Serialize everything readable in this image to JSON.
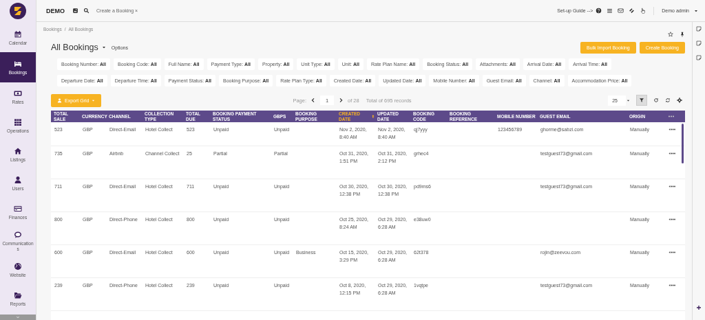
{
  "sidebar": {
    "items": [
      {
        "label": "Calendar",
        "selected": false
      },
      {
        "label": "Bookings",
        "selected": true
      },
      {
        "label": "Rates",
        "selected": false
      },
      {
        "label": "Operations",
        "selected": false
      },
      {
        "label": "Listings",
        "selected": false
      },
      {
        "label": "Users",
        "selected": false
      },
      {
        "label": "Finances",
        "selected": false
      },
      {
        "label": "Communications",
        "selected": false
      },
      {
        "label": "Website",
        "selected": false
      },
      {
        "label": "Reports",
        "selected": false
      }
    ]
  },
  "topbar": {
    "brand": "DEMO",
    "open_tab": "Create a Booking ×",
    "guide": "Set-up Guide -->",
    "user": "Demo admin"
  },
  "breadcrumb": [
    "Bookings",
    "/",
    "All Bookings"
  ],
  "page": {
    "title": "All Bookings",
    "options": "Options",
    "buttons": [
      "Bulk Import Booking",
      "Create Booking"
    ]
  },
  "filters": [
    {
      "label": "Booking Number:",
      "value": "All"
    },
    {
      "label": "Booking Code:",
      "value": "All"
    },
    {
      "label": "Full Name:",
      "value": "All"
    },
    {
      "label": "Payment Type:",
      "value": "All"
    },
    {
      "label": "Property:",
      "value": "All"
    },
    {
      "label": "Unit Type:",
      "value": "All"
    },
    {
      "label": "Unit:",
      "value": "All"
    },
    {
      "label": "Rate Plan Name:",
      "value": "All"
    },
    {
      "label": "Booking Status:",
      "value": "All"
    },
    {
      "label": "Attachments:",
      "value": "All"
    },
    {
      "label": "Arrival Date:",
      "value": "All"
    },
    {
      "label": "Arrival Time:",
      "value": "All"
    },
    {
      "label": "Departure Date:",
      "value": "All"
    },
    {
      "label": "Departure Time:",
      "value": "All"
    },
    {
      "label": "Payment Status:",
      "value": "All"
    },
    {
      "label": "Booking Purpose:",
      "value": "All"
    },
    {
      "label": "Rate Plan Type:",
      "value": "All"
    },
    {
      "label": "Created Date:",
      "value": "All"
    },
    {
      "label": "Updated Date:",
      "value": "All"
    },
    {
      "label": "Mobile Number:",
      "value": "All"
    },
    {
      "label": "Guest Email:",
      "value": "All"
    },
    {
      "label": "Channel:",
      "value": "All"
    },
    {
      "label": "Accommodation Price:",
      "value": "All"
    }
  ],
  "toolbar": {
    "export": "Export Grid",
    "page_label": "Page:",
    "page": "1",
    "of_pages": "of 28",
    "total": "Total of 695 records",
    "page_size": "25",
    "filter_active": true
  },
  "table": {
    "columns": [
      {
        "label": "TOTAL SALE",
        "sorted": false
      },
      {
        "label": "CURRENCY",
        "sorted": false
      },
      {
        "label": "CHANNEL",
        "sorted": false
      },
      {
        "label": "COLLECTION TYPE",
        "sorted": false
      },
      {
        "label": "TOTAL DUE",
        "sorted": false
      },
      {
        "label": "BOOKING PAYMENT STATUS",
        "sorted": false
      },
      {
        "label": "GBPS",
        "sorted": false
      },
      {
        "label": "BOOKING PURPOSE",
        "sorted": false
      },
      {
        "label": "CREATED DATE",
        "sorted": true
      },
      {
        "label": "UPDATED DATE",
        "sorted": false
      },
      {
        "label": "BOOKING CODE",
        "sorted": false
      },
      {
        "label": "BOOKING REFERENCE",
        "sorted": false
      },
      {
        "label": "MOBILE NUMBER",
        "sorted": false
      },
      {
        "label": "GUEST EMAIL",
        "sorted": false
      },
      {
        "label": "ORIGIN",
        "sorted": false
      }
    ],
    "rows": [
      [
        "523",
        "GBP",
        "Direct-Email",
        "Hotel Collect",
        "523",
        "Unpaid",
        "Unpaid",
        "",
        "Nov 2, 2020, 8:40 AM",
        "Nov 2, 2020, 8:40 AM",
        "qj7yyy",
        "",
        "123456789",
        "ghorme@sabzi.com",
        "Manually"
      ],
      [
        "735",
        "GBP",
        "Airbnb",
        "Channel Collect",
        "25",
        "Partial",
        "Partial",
        "",
        "Oct 31, 2020, 1:51 PM",
        "Oct 31, 2020, 2:12 PM",
        "grhec4",
        "",
        "",
        "testguest73@gmail.com",
        "Manually"
      ],
      [
        "711",
        "GBP",
        "Direct-Email",
        "Hotel Collect",
        "711",
        "Unpaid",
        "Unpaid",
        "",
        "Oct 30, 2020, 12:38 PM",
        "Oct 30, 2020, 12:38 PM",
        "pd9ms6",
        "",
        "",
        "testguest73@gmail.com",
        "Manually"
      ],
      [
        "800",
        "GBP",
        "Direct-Phone",
        "Hotel Collect",
        "800",
        "Unpaid",
        "Unpaid",
        "",
        "Oct 25, 2020, 8:24 AM",
        "Oct 29, 2020, 6:28 AM",
        "e38uw0",
        "",
        "",
        "",
        "Manually"
      ],
      [
        "600",
        "GBP",
        "Direct-Email",
        "Hotel Collect",
        "600",
        "Unpaid",
        "Unpaid",
        "Business",
        "Oct 15, 2020, 3:29 PM",
        "Oct 29, 2020, 6:28 AM",
        "62t378",
        "",
        "",
        "rojin@zeevou.com",
        "Manually"
      ],
      [
        "239",
        "GBP",
        "Direct-Phone",
        "Hotel Collect",
        "239",
        "Unpaid",
        "Unpaid",
        "",
        "Oct 8, 2020, 12:15 PM",
        "Oct 29, 2020, 6:28 AM",
        "1vqtpe",
        "",
        "",
        "testguest73@gmail.com",
        "Manually"
      ]
    ]
  }
}
